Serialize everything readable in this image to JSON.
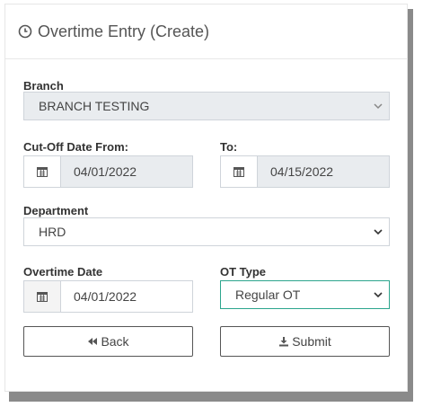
{
  "header": {
    "title": "Overtime Entry (Create)",
    "icon": "clock-icon"
  },
  "branch": {
    "label": "Branch",
    "value": "BRANCH TESTING"
  },
  "cutoff_from": {
    "label": "Cut-Off Date From:",
    "value": "04/01/2022"
  },
  "cutoff_to": {
    "label": "To:",
    "value": "04/15/2022"
  },
  "department": {
    "label": "Department",
    "value": "HRD"
  },
  "overtime_date": {
    "label": "Overtime Date",
    "value": "04/01/2022"
  },
  "ot_type": {
    "label": "OT Type",
    "value": "Regular OT"
  },
  "buttons": {
    "back": "Back",
    "submit": "Submit"
  },
  "colors": {
    "focus_border": "#2ca58d",
    "disabled_bg": "#e9ecef"
  }
}
